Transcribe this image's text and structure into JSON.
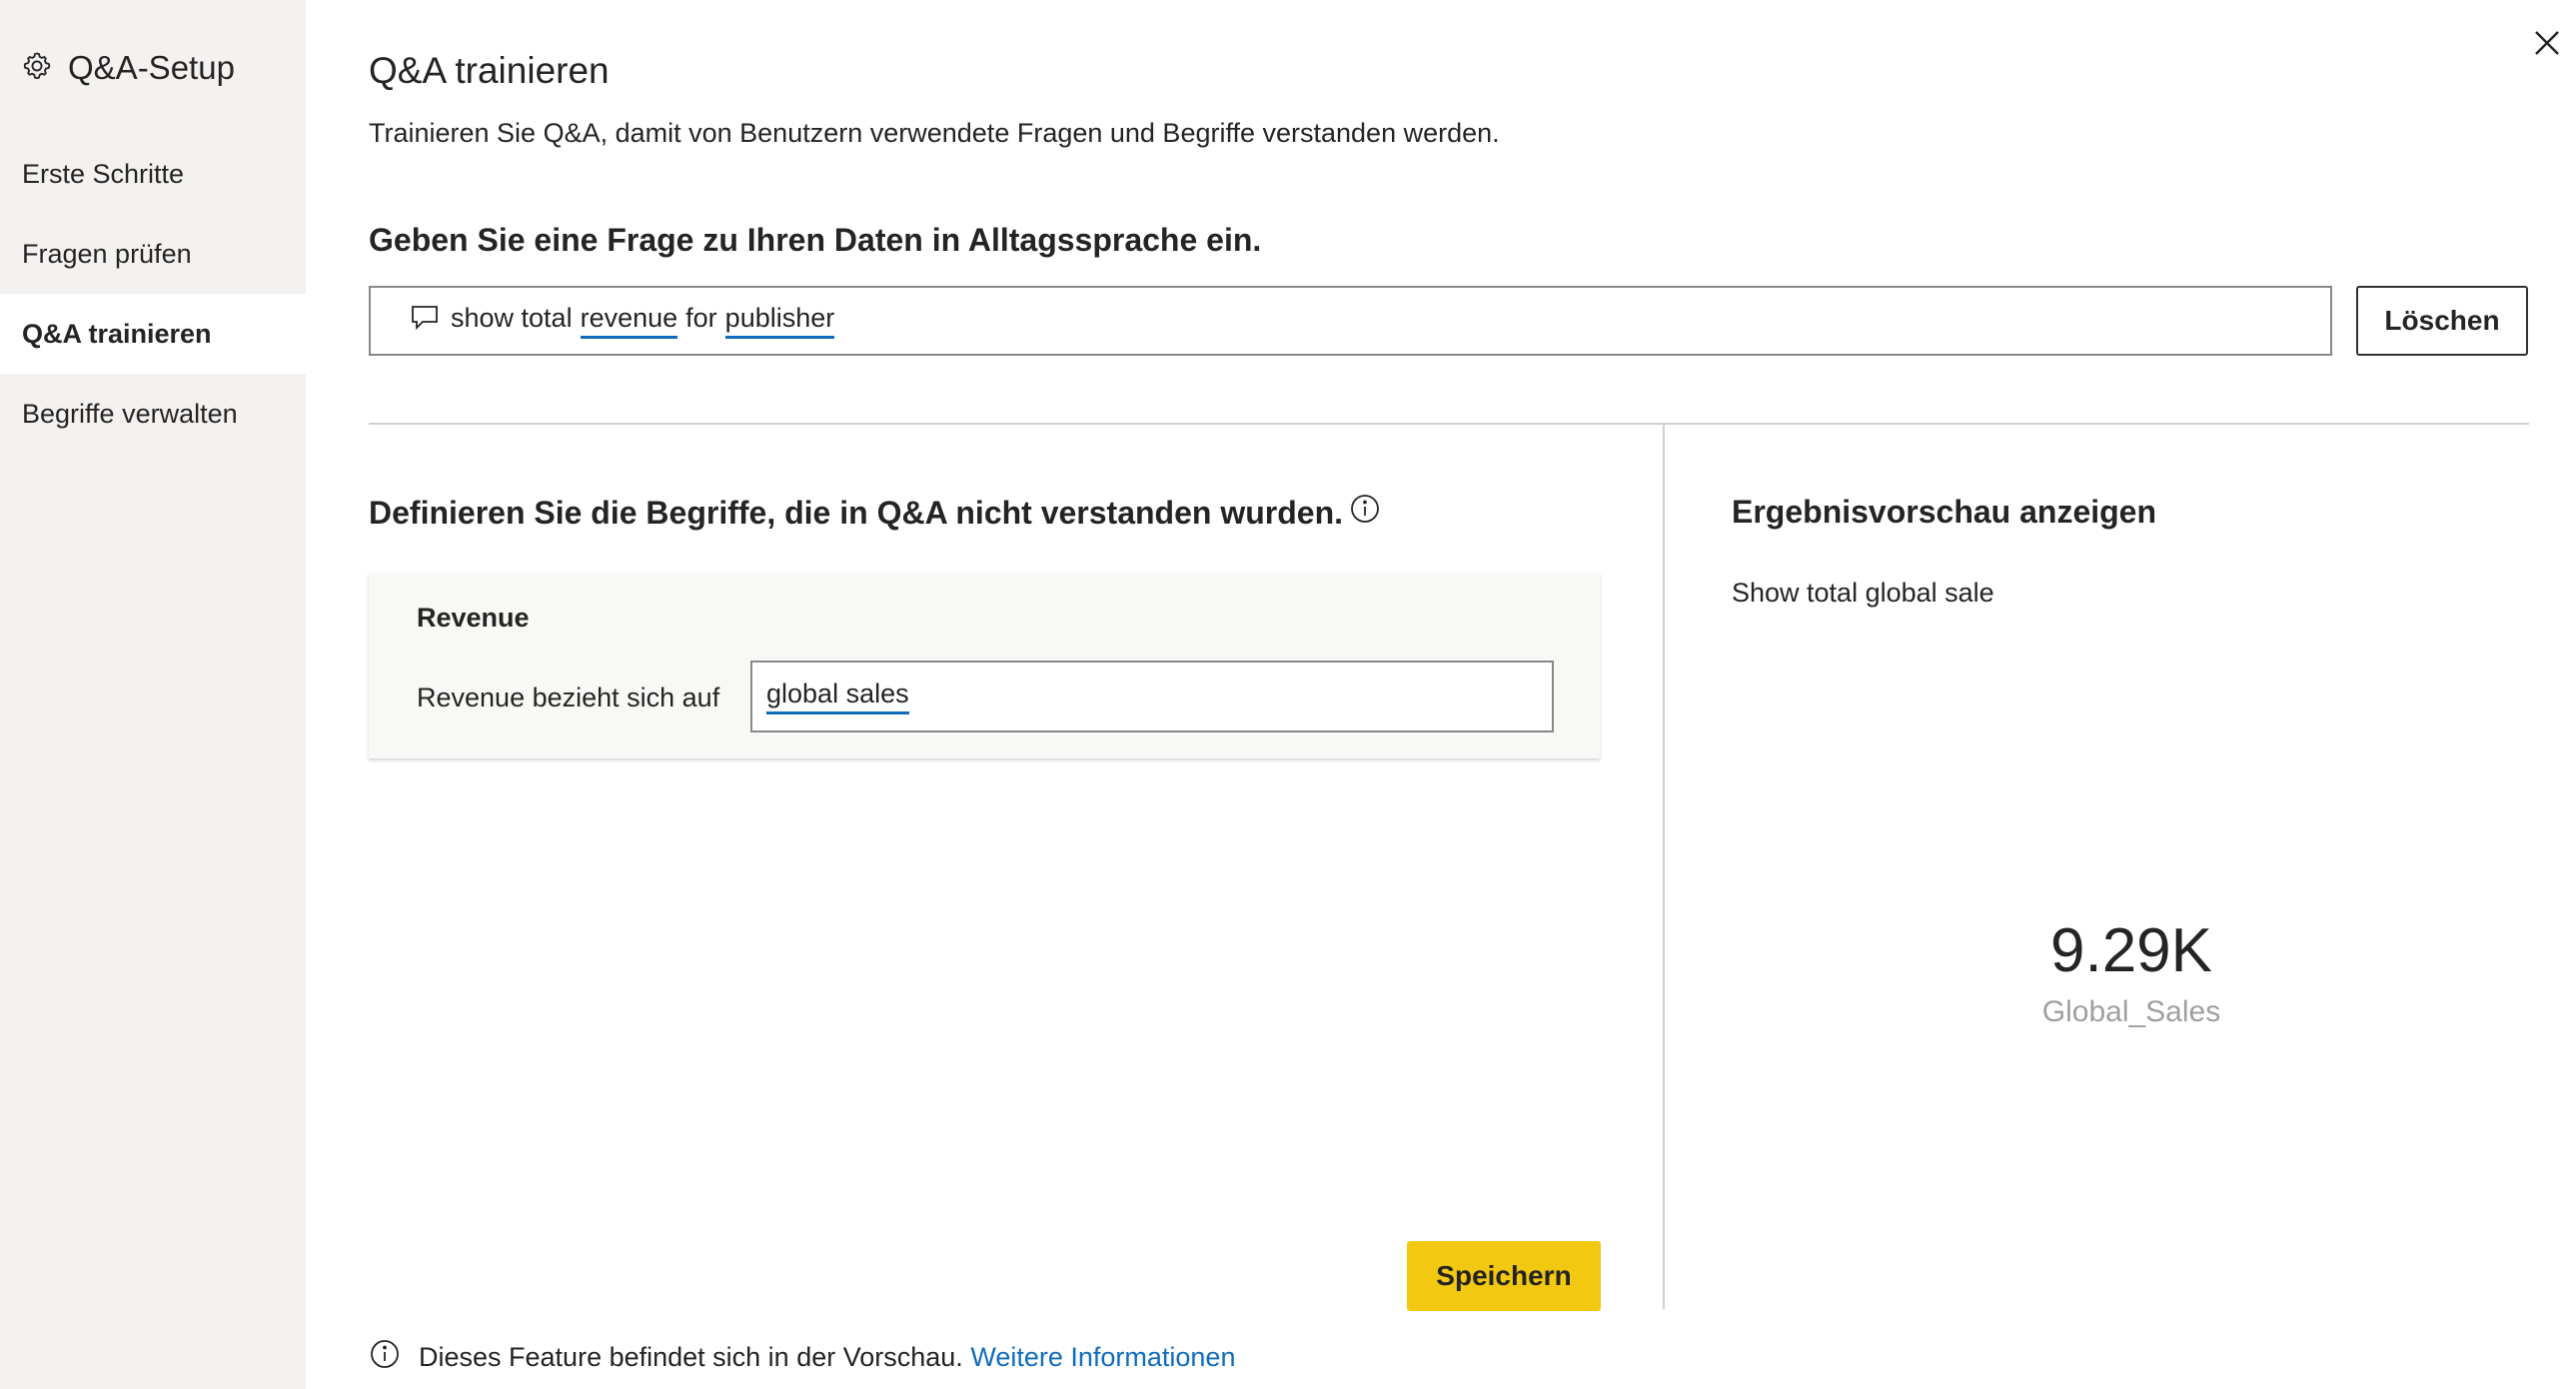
{
  "sidebar": {
    "title": "Q&A-Setup",
    "icon": "gear-icon",
    "items": [
      {
        "label": "Erste Schritte",
        "active": false
      },
      {
        "label": "Fragen prüfen",
        "active": false
      },
      {
        "label": "Q&A trainieren",
        "active": true
      },
      {
        "label": "Begriffe verwalten",
        "active": false
      }
    ]
  },
  "main": {
    "title": "Q&A trainieren",
    "subtitle": "Trainieren Sie Q&A, damit von Benutzern verwendete Fragen und Begriffe verstanden werden.",
    "question_label": "Geben Sie eine Frage zu Ihren Daten in Alltagssprache ein.",
    "question": {
      "icon": "comment-icon",
      "words": [
        "show total",
        "revenue",
        "for",
        "publisher"
      ],
      "underlined": [
        "revenue",
        "publisher"
      ]
    },
    "clear_label": "Löschen",
    "define_title": "Definieren Sie die Begriffe, die in Q&A nicht verstanden wurden.",
    "term": {
      "name": "Revenue",
      "refers_label": "Revenue bezieht sich auf",
      "value": "global sales"
    },
    "save_label": "Speichern",
    "footer": {
      "text": "Dieses Feature befindet sich in der Vorschau.",
      "link": "Weitere Informationen"
    }
  },
  "preview": {
    "title": "Ergebnisvorschau anzeigen",
    "question": "Show total global sale",
    "kpi_value": "9.29K",
    "kpi_label": "Global_Sales"
  },
  "colors": {
    "accent_yellow": "#f2c811",
    "link_blue": "#0f6cbd",
    "sidebar_bg": "#f3f2f1"
  }
}
